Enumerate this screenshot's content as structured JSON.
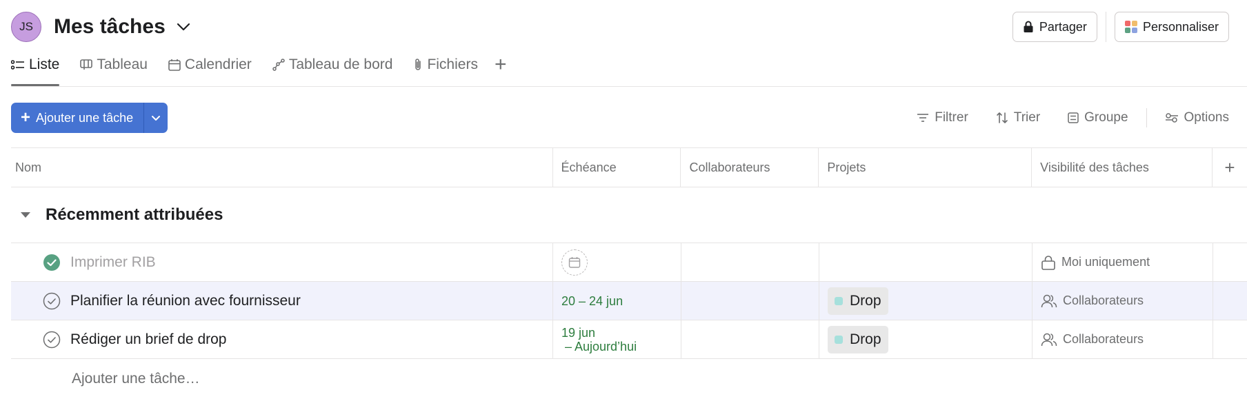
{
  "header": {
    "avatar_initials": "JS",
    "title": "Mes tâches",
    "share_label": "Partager",
    "customize_label": "Personnaliser"
  },
  "tabs": [
    {
      "label": "Liste",
      "icon": "list-icon",
      "active": true
    },
    {
      "label": "Tableau",
      "icon": "board-icon",
      "active": false
    },
    {
      "label": "Calendrier",
      "icon": "calendar-icon",
      "active": false
    },
    {
      "label": "Tableau de bord",
      "icon": "dashboard-icon",
      "active": false
    },
    {
      "label": "Fichiers",
      "icon": "paperclip-icon",
      "active": false
    }
  ],
  "tabs_add": "+",
  "toolbar": {
    "add_task_label": "Ajouter une tâche",
    "filter_label": "Filtrer",
    "sort_label": "Trier",
    "group_label": "Groupe",
    "options_label": "Options"
  },
  "columns": [
    "Nom",
    "Échéance",
    "Collaborateurs",
    "Projets",
    "Visibilité des tâches"
  ],
  "columns_add": "+",
  "section": {
    "title": "Récemment attribuées"
  },
  "tasks": [
    {
      "name": "Imprimer RIB",
      "completed": true,
      "due": "",
      "due_line2": "",
      "project": "",
      "visibility": "Moi uniquement",
      "visibility_icon": "lock-icon"
    },
    {
      "name": "Planifier la réunion avec fournisseur",
      "completed": false,
      "due": "20 – 24 jun",
      "due_line2": "",
      "project": "Drop",
      "visibility": "Collaborateurs",
      "visibility_icon": "people-icon"
    },
    {
      "name": "Rédiger un brief de drop",
      "completed": false,
      "due": "19 jun",
      "due_line2": "– Aujourd’hui",
      "project": "Drop",
      "visibility": "Collaborateurs",
      "visibility_icon": "people-icon"
    }
  ],
  "add_task_inline": "Ajouter une tâche…",
  "colors": {
    "primary": "#4573d2",
    "due_green": "#2d7d3e",
    "project_chip": "#a6e0dc",
    "done_check": "#58a182",
    "avatar": "#c69ddf"
  }
}
